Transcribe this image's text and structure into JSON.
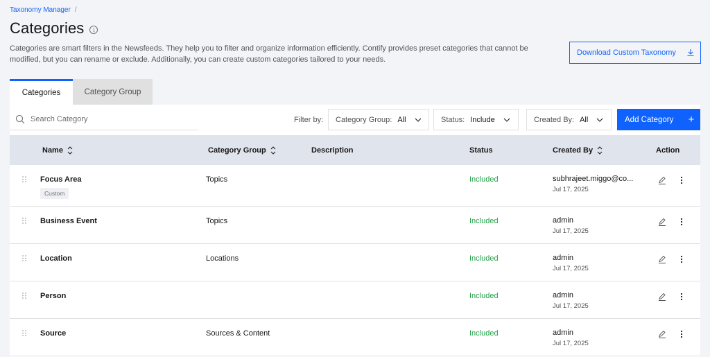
{
  "breadcrumb": {
    "root": "Taxonomy Manager",
    "separator": "/"
  },
  "page": {
    "title": "Categories",
    "description": "Categories are smart filters in the Newsfeeds. They help you to filter and organize information efficiently. Contify provides preset categories that cannot be modified, but you can rename or exclude. Additionally, you can create custom categories tailored to your needs.",
    "download_label": "Download Custom Taxonomy"
  },
  "tabs": [
    {
      "label": "Categories",
      "active": true
    },
    {
      "label": "Category Group",
      "active": false
    }
  ],
  "toolbar": {
    "search_placeholder": "Search Category",
    "filter_label": "Filter by:",
    "filters": [
      {
        "label": "Category Group:",
        "value": "All"
      },
      {
        "label": "Status:",
        "value": "Include"
      },
      {
        "label": "Created By:",
        "value": "All"
      }
    ],
    "add_label": "Add Category",
    "add_icon": "+"
  },
  "table": {
    "columns": [
      "Name",
      "Category Group",
      "Description",
      "Status",
      "Created By",
      "Action"
    ],
    "rows": [
      {
        "name": "Focus Area",
        "tag": "Custom",
        "group": "Topics",
        "description": "",
        "status": "Included",
        "created_by": "subhrajeet.miggo@co...",
        "date": "Jul 17, 2025"
      },
      {
        "name": "Business Event",
        "tag": "",
        "group": "Topics",
        "description": "",
        "status": "Included",
        "created_by": "admin",
        "date": "Jul 17, 2025"
      },
      {
        "name": "Location",
        "tag": "",
        "group": "Locations",
        "description": "",
        "status": "Included",
        "created_by": "admin",
        "date": "Jul 17, 2025"
      },
      {
        "name": "Person",
        "tag": "",
        "group": "",
        "description": "",
        "status": "Included",
        "created_by": "admin",
        "date": "Jul 17, 2025"
      },
      {
        "name": "Source",
        "tag": "",
        "group": "Sources & Content",
        "description": "",
        "status": "Included",
        "created_by": "admin",
        "date": "Jul 17, 2025"
      }
    ]
  },
  "colors": {
    "accent": "#0f62fe",
    "status_included": "#24a148",
    "page_bg": "#f2f4f8",
    "header_bg": "#e0e4ec"
  },
  "icons": {
    "info": "info-icon",
    "download": "download-icon",
    "search": "search-icon",
    "chevron": "chevron-down-icon",
    "sort": "sort-icon",
    "drag": "drag-handle-icon",
    "edit": "edit-icon",
    "more": "overflow-menu-icon"
  }
}
